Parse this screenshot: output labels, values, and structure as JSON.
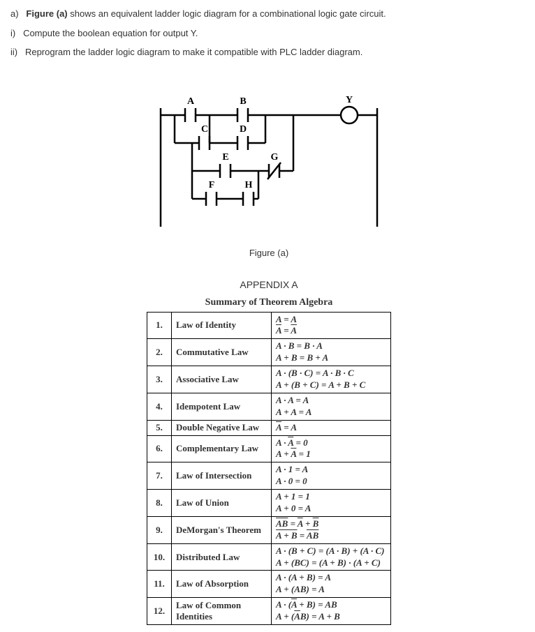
{
  "question": {
    "part_a_label": "a)",
    "part_a_text_bold": "Figure (a)",
    "part_a_text_rest": " shows an equivalent ladder logic diagram for a combinational logic gate circuit.",
    "i_label": "i)",
    "i_text": "Compute the boolean equation for output Y.",
    "ii_label": "ii)",
    "ii_text": "Reprogram the ladder logic diagram to make it compatible with PLC ladder diagram."
  },
  "figure": {
    "label_A": "A",
    "label_B": "B",
    "label_C": "C",
    "label_D": "D",
    "label_E": "E",
    "label_F": "F",
    "label_G": "G",
    "label_H": "H",
    "label_Y": "Y",
    "caption": "Figure (a)"
  },
  "appendix": {
    "title": "APPENDIX A",
    "table_title": "Summary of Theorem Algebra",
    "rows": [
      {
        "num": "1.",
        "name": "Law of Identity"
      },
      {
        "num": "2.",
        "name": "Commutative Law"
      },
      {
        "num": "3.",
        "name": "Associative Law"
      },
      {
        "num": "4.",
        "name": "Idempotent Law"
      },
      {
        "num": "5.",
        "name": "Double Negative Law"
      },
      {
        "num": "6.",
        "name": "Complementary Law"
      },
      {
        "num": "7.",
        "name": "Law of Intersection"
      },
      {
        "num": "8.",
        "name": "Law of Union"
      },
      {
        "num": "9.",
        "name": "DeMorgan's Theorem"
      },
      {
        "num": "10.",
        "name": "Distributed Law"
      },
      {
        "num": "11.",
        "name": "Law of Absorption"
      },
      {
        "num": "12.",
        "name": "Law of Common Identities"
      }
    ],
    "formulas": {
      "1a": "A = A",
      "1b_lhs_over": "A",
      "1b_rhs_over": "A",
      "2a": "A · B = B · A",
      "2b": "A + B = B + A",
      "3a": "A · (B · C) = A · B · C",
      "3b": "A + (B + C) = A + B + C",
      "4a": "A · A = A",
      "4b": "A + A = A",
      "5_over2_over": "A",
      "5_rhs": " = A",
      "6a_lhs": "A · ",
      "6a_over": "A",
      "6a_rhs": " = 0",
      "6b_lhs": "A + ",
      "6b_over": "A",
      "6b_rhs": " = 1",
      "7a": "A · 1 = A",
      "7b": "A · 0 = 0",
      "8a": "A + 1 = 1",
      "8b": "A + 0 = A",
      "9a_over": "AB",
      "9a_mid": " = ",
      "9a_over2": "A",
      "9a_plus": " + ",
      "9a_over3": "B",
      "9b_over": "A + B",
      "9b_mid": " = ",
      "9b_over2": "AB",
      "10a": "A · (B + C) = (A · B) + (A · C)",
      "10b": "A + (BC) = (A + B) · (A + C)",
      "11a": "A · (A + B) = A",
      "11b": "A + (AB) = A",
      "12a_lhs": "A · (",
      "12a_over": "A",
      "12a_rhs": " + B) = AB",
      "12b_lhs": "A + (",
      "12b_over": "A",
      "12b_rhs": "B) = A + B"
    }
  }
}
